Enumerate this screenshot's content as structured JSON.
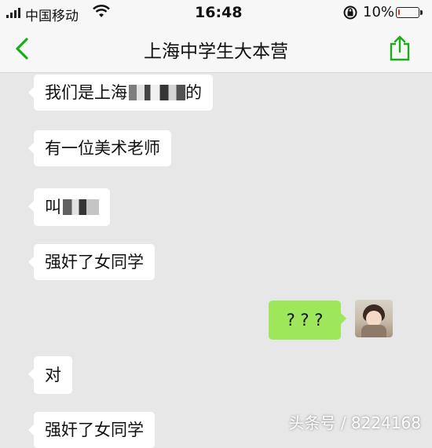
{
  "status_bar": {
    "carrier": "中国移动",
    "time": "16:48",
    "battery_percent": "10%",
    "battery_level": 0.1,
    "battery_color": "#e0332b"
  },
  "nav": {
    "title": "上海中学生大本营",
    "back_icon": "chevron-left-icon",
    "share_icon": "share-icon",
    "accent_color": "#1aad19"
  },
  "messages": [
    {
      "direction": "in",
      "text": "我们是上海",
      "suffix": "的",
      "redacted": true
    },
    {
      "direction": "in",
      "text": "有一位美术老师"
    },
    {
      "direction": "in",
      "text": "叫",
      "redacted": true
    },
    {
      "direction": "in",
      "text": "强奸了女同学"
    },
    {
      "direction": "out",
      "text": "? ? ?"
    },
    {
      "direction": "in",
      "text": "对"
    },
    {
      "direction": "in",
      "text": "强奸了女同学"
    }
  ],
  "watermark": "头条号 / 8224168"
}
